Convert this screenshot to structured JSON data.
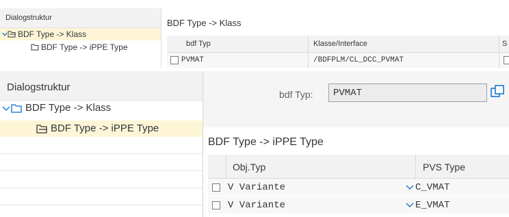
{
  "back": {
    "dialog_title": "Dialogstruktur",
    "tree": [
      {
        "label": "BDF Type -> Klass"
      },
      {
        "label": "BDF Type -> iPPE Type"
      }
    ],
    "main_title": "BDF Type -> Klass",
    "table": {
      "headers": [
        "bdf Typ",
        "Klasse/Interface",
        "S"
      ],
      "rows": [
        {
          "bdf_typ": "PVMAT",
          "klasse": "/BDFPLM/CL_DCC_PVMAT"
        }
      ]
    }
  },
  "front": {
    "dialog_title": "Dialogstruktur",
    "tree": [
      {
        "label": "BDF Type -> Klass"
      },
      {
        "label": "BDF Type -> iPPE Type"
      }
    ],
    "field_label": "bdf Typ:",
    "field_value": "PVMAT",
    "section_title": "BDF Type -> iPPE Type",
    "table": {
      "headers": [
        "Obj.Typ",
        "PVS Type"
      ],
      "rows": [
        {
          "obj_typ": "V Variante",
          "pvs_type": "C_VMAT"
        },
        {
          "obj_typ": "V Variante",
          "pvs_type": "E_VMAT"
        }
      ]
    }
  },
  "colors": {
    "selection": "#fdf5d6",
    "header_bg": "#f2f2f2",
    "accent": "#0a6ed1"
  },
  "icons": {
    "folder_open": "folder-open-icon",
    "folder": "folder-icon",
    "tree_expanded": "chevron-down-icon",
    "dropdown": "chevron-down-icon",
    "value_help": "value-help-icon"
  }
}
